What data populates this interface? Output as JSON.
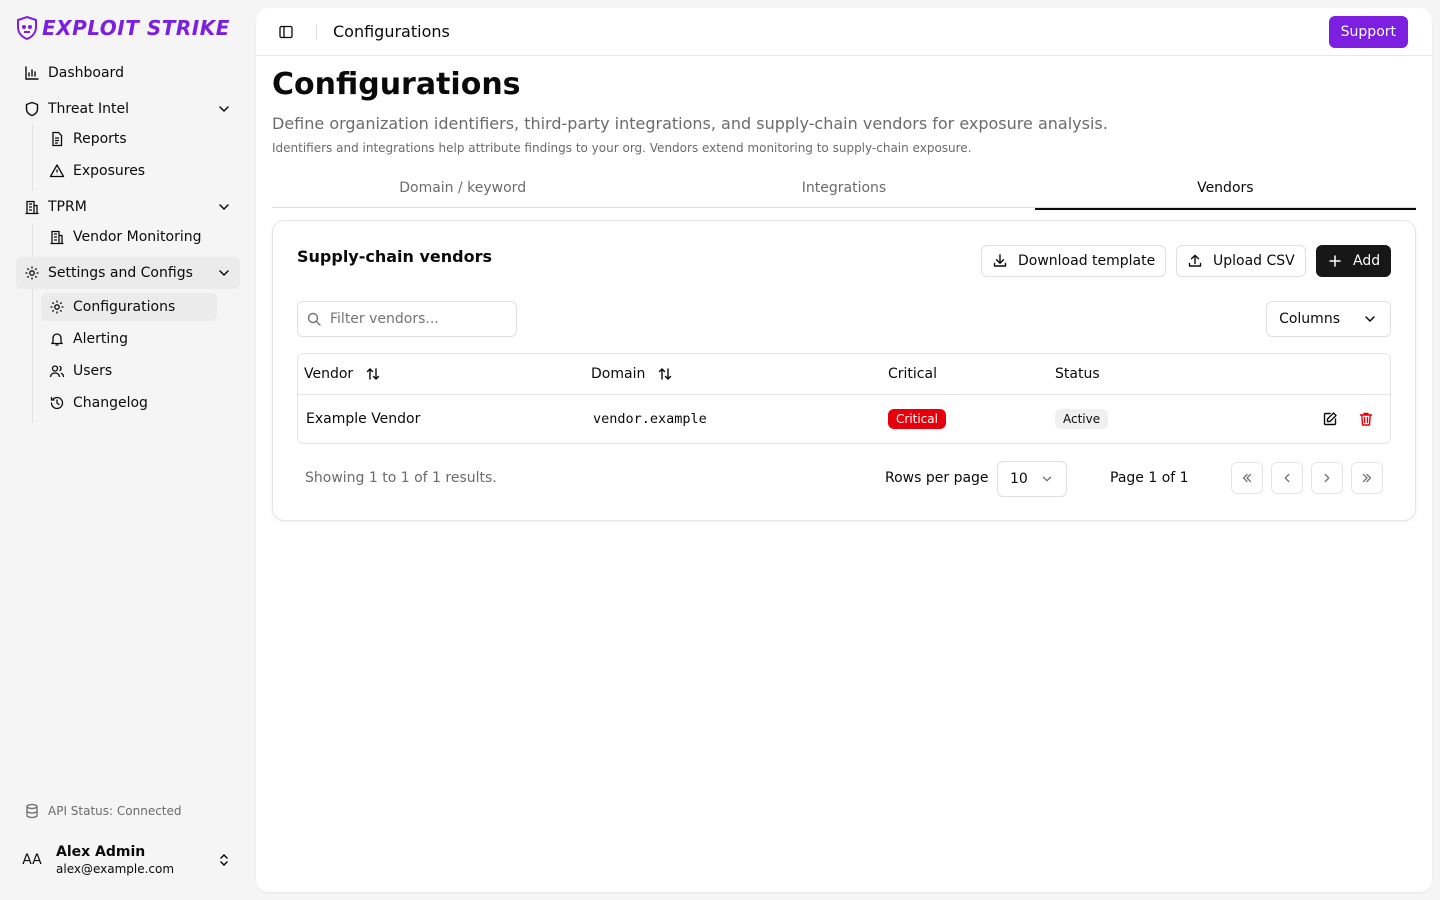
{
  "app": {
    "brand": "EXPLOIT STRIKE",
    "accent_color": "#7c1fe0"
  },
  "sidebar": {
    "items": [
      {
        "label": "Dashboard",
        "icon": "bar-chart-icon"
      },
      {
        "label": "Threat Intel",
        "icon": "shield-icon",
        "children": [
          {
            "label": "Reports",
            "icon": "file-text-icon"
          },
          {
            "label": "Exposures",
            "icon": "alert-triangle-icon"
          }
        ]
      },
      {
        "label": "TPRM",
        "icon": "building-icon",
        "children": [
          {
            "label": "Vendor Monitoring",
            "icon": "building-icon"
          }
        ]
      },
      {
        "label": "Settings and Configs",
        "icon": "gear-icon",
        "children": [
          {
            "label": "Configurations",
            "icon": "gear-icon"
          },
          {
            "label": "Alerting",
            "icon": "bell-icon"
          },
          {
            "label": "Users",
            "icon": "users-icon"
          },
          {
            "label": "Changelog",
            "icon": "history-icon"
          }
        ]
      }
    ],
    "api_status": "API Status: Connected",
    "user": {
      "initials": "AA",
      "name": "Alex Admin",
      "email": "alex@example.com"
    }
  },
  "header": {
    "breadcrumb": "Configurations",
    "support_label": "Support"
  },
  "page": {
    "title": "Configurations",
    "description": "Define organization identifiers, third-party integrations, and supply-chain vendors for exposure analysis.",
    "note": "Identifiers and integrations help attribute findings to your org. Vendors extend monitoring to supply-chain exposure.",
    "tabs": [
      {
        "label": "Domain / keyword",
        "selected": false
      },
      {
        "label": "Integrations",
        "selected": false
      },
      {
        "label": "Vendors",
        "selected": true
      }
    ]
  },
  "vendors": {
    "title": "Supply-chain vendors",
    "download_label": "Download template",
    "upload_label": "Upload CSV",
    "add_label": "Add",
    "filter_placeholder": "Filter vendors...",
    "columns_label": "Columns",
    "headers": {
      "vendor": "Vendor",
      "domain": "Domain",
      "critical": "Critical",
      "status": "Status"
    },
    "rows": [
      {
        "vendor": "Example Vendor",
        "domain": "vendor.example",
        "critical": "Critical",
        "status": "Active"
      }
    ],
    "footer": {
      "summary": "Showing 1 to 1 of 1 results.",
      "rows_per_page_label": "Rows per page",
      "rows_per_page": "10",
      "page_label": "Page 1 of 1"
    },
    "critical_color": "#e7000b"
  }
}
